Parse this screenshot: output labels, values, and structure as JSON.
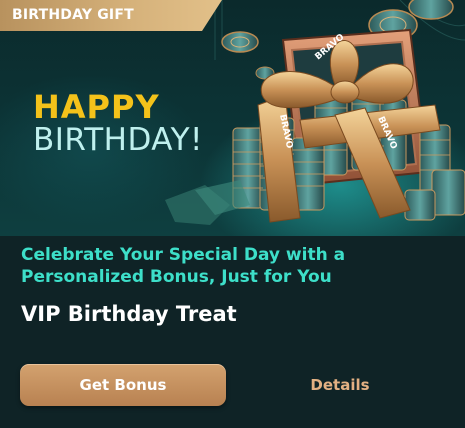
{
  "hero": {
    "tag_label": "BIRTHDAY GIFT",
    "headline_line1": "HAPPY",
    "headline_line2": "BIRTHDAY!",
    "ribbon_brand": "BRAVO",
    "icons": [
      "gift-box-icon",
      "poker-chip-icon",
      "chip-stack-icon"
    ]
  },
  "offer": {
    "description": "Celebrate Your Special Day with a Personalized Bonus, Just for You",
    "title": "VIP Birthday Treat"
  },
  "actions": {
    "primary_label": "Get Bonus",
    "secondary_label": "Details"
  },
  "colors": {
    "tag_gold": "#d6b27b",
    "headline_yellow": "#f4c21a",
    "headline_mint": "#bff0ee",
    "accent_teal": "#3ddfc9",
    "button_bronze": "#c4905e",
    "link_bronze": "#e3b183",
    "background": "#0f2326"
  }
}
